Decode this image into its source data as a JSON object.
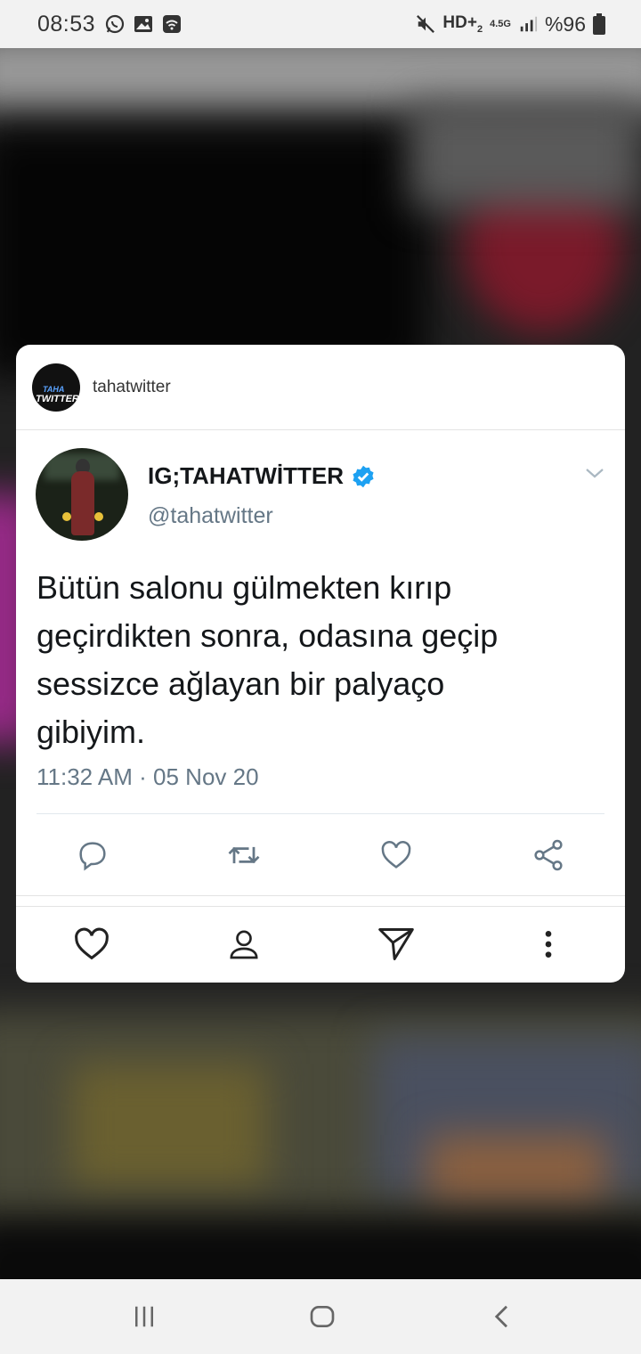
{
  "status_bar": {
    "time": "08:53",
    "left_icons": [
      "whatsapp-icon",
      "image-icon",
      "wifi-call-icon"
    ],
    "network": "HD+",
    "network_sub": "2",
    "network_gen": "4.5G",
    "battery_text": "%96"
  },
  "card": {
    "source_user": "tahatwitter",
    "avatar_text_top": "TAHA",
    "avatar_text_bottom": "TWITTER"
  },
  "tweet": {
    "display_name": "IG;TAHATWİTTER",
    "handle": "@tahatwitter",
    "text": "Bütün salonu gülmekten kırıp\ngeçirdikten sonra, odasına geçip\nsessizce ağlayan bir palyaço\ngibiyim.",
    "timestamp": "11:32 AM · 05 Nov 20",
    "verified": true,
    "accent_color": "#1da1f2"
  },
  "tweet_actions": [
    "reply-icon",
    "retweet-icon",
    "like-icon",
    "share-icon"
  ],
  "card_actions": [
    "heart-icon",
    "profile-icon",
    "send-icon",
    "more-icon"
  ],
  "nav_bar": [
    "recent-apps-icon",
    "home-icon",
    "back-icon"
  ]
}
